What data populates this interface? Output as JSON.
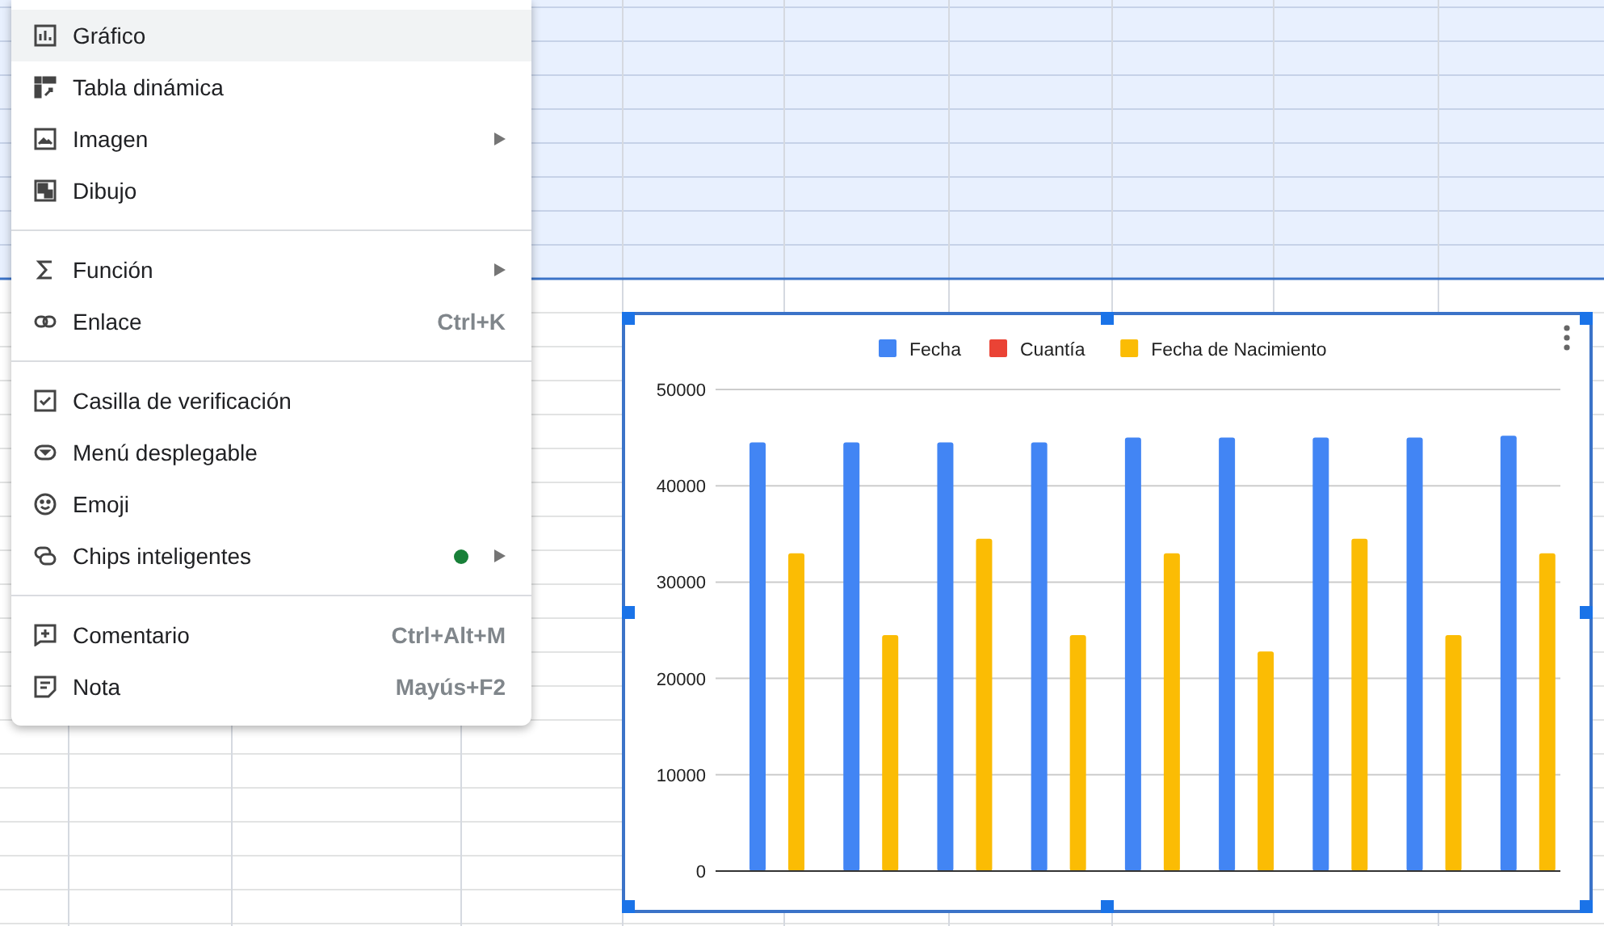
{
  "insert_menu": {
    "sections": [
      [
        {
          "label": "Gráfico",
          "selected": true,
          "submenu": false,
          "dot": false
        },
        {
          "label": "Tabla dinámica",
          "selected": false,
          "submenu": false,
          "dot": false
        },
        {
          "label": "Imagen",
          "selected": false,
          "submenu": true,
          "dot": false
        },
        {
          "label": "Dibujo",
          "selected": false,
          "submenu": false,
          "dot": false
        }
      ],
      [
        {
          "label": "Función",
          "selected": false,
          "submenu": true,
          "dot": false
        },
        {
          "label": "Enlace",
          "shortcut": "Ctrl+K",
          "selected": false,
          "submenu": false,
          "dot": false
        }
      ],
      [
        {
          "label": "Casilla de verificación",
          "selected": false,
          "submenu": false,
          "dot": false
        },
        {
          "label": "Menú desplegable",
          "selected": false,
          "submenu": false,
          "dot": false
        },
        {
          "label": "Emoji",
          "selected": false,
          "submenu": false,
          "dot": false
        },
        {
          "label": "Chips inteligentes",
          "selected": false,
          "submenu": true,
          "dot": true
        }
      ],
      [
        {
          "label": "Comentario",
          "shortcut": "Ctrl+Alt+M",
          "selected": false,
          "submenu": false,
          "dot": false
        },
        {
          "label": "Nota",
          "shortcut": "Mayús+F2",
          "selected": false,
          "submenu": false,
          "dot": false
        }
      ]
    ]
  },
  "chart": {
    "selected": true,
    "chart_data": {
      "type": "bar",
      "orientation": "vertical",
      "grid": true,
      "legend": true,
      "ylim": [
        0,
        50000
      ],
      "yticks": [
        0,
        10000,
        20000,
        30000,
        40000,
        50000
      ],
      "series": [
        {
          "name": "Fecha",
          "color": "#4285f4",
          "values": [
            44500,
            44500,
            44500,
            44500,
            45000,
            45000,
            45000,
            45000,
            45200
          ]
        },
        {
          "name": "Cuantía",
          "color": "#ea4335",
          "values": [
            null,
            null,
            null,
            null,
            null,
            null,
            null,
            null,
            null
          ]
        },
        {
          "name": "Fecha de Nacimiento",
          "color": "#fbbc04",
          "values": [
            33000,
            24500,
            34500,
            24500,
            33000,
            22800,
            34500,
            24500,
            33000
          ]
        }
      ]
    }
  }
}
